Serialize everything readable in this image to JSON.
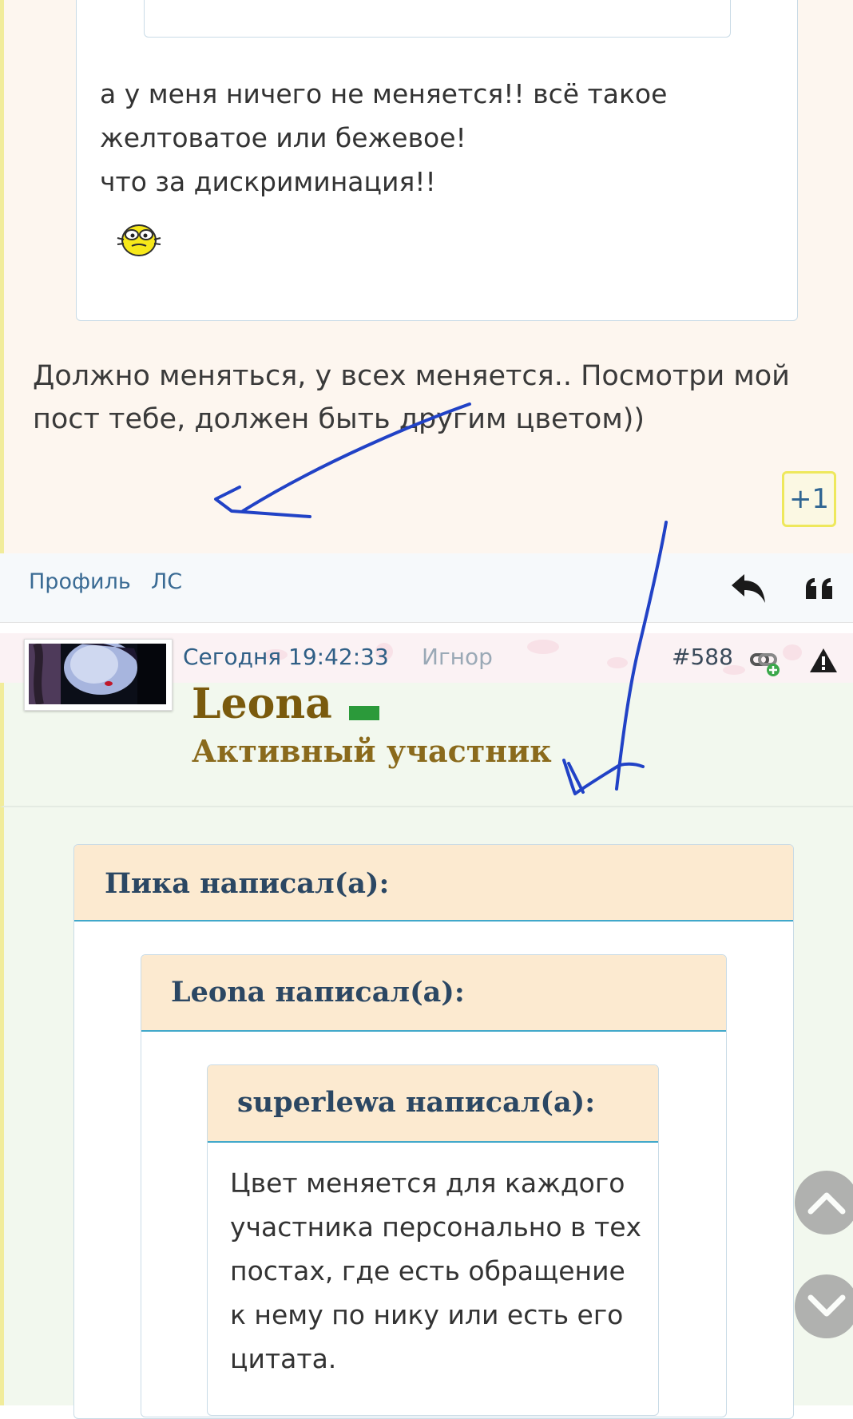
{
  "post1": {
    "quoted_lines": [
      "а у меня ничего не меняется!! всё такое",
      "желтоватое или бежевое!",
      "что за дискриминация!!"
    ],
    "reply_text": "Должно меняться, у всех меняется.. Посмотри мой пост тебе, должен быть другим цветом))",
    "plus_label": "+1",
    "footer": {
      "profile": "Профиль",
      "pm": "ЛС"
    }
  },
  "post2": {
    "date": "Сегодня 19:42:33",
    "ignore": "Игнор",
    "number": "#588",
    "username": "Leona",
    "rank": "Активный участник",
    "quote_outer_author": "Пика написал(а):",
    "quote_middle_author": "Leona написал(а):",
    "quote_inner_author": "superlewa написал(а):",
    "quote_inner_text": "Цвет меняется для каждого участника персонально в тех постах, где есть обращение к нему по нику или есть его цитата."
  },
  "colors": {
    "accent_blue": "#2f5f86",
    "username_gold": "#7a5a0d",
    "online_green": "#2b9a3a",
    "quote_header_bg": "#fcead0",
    "quote_header_border": "#41a8ca",
    "annotation_ink": "#2142c6"
  },
  "icons": [
    "smiley-icon",
    "reply-icon",
    "quote-icon",
    "link-icon",
    "warning-icon",
    "chevron-up-icon",
    "chevron-down-icon"
  ]
}
